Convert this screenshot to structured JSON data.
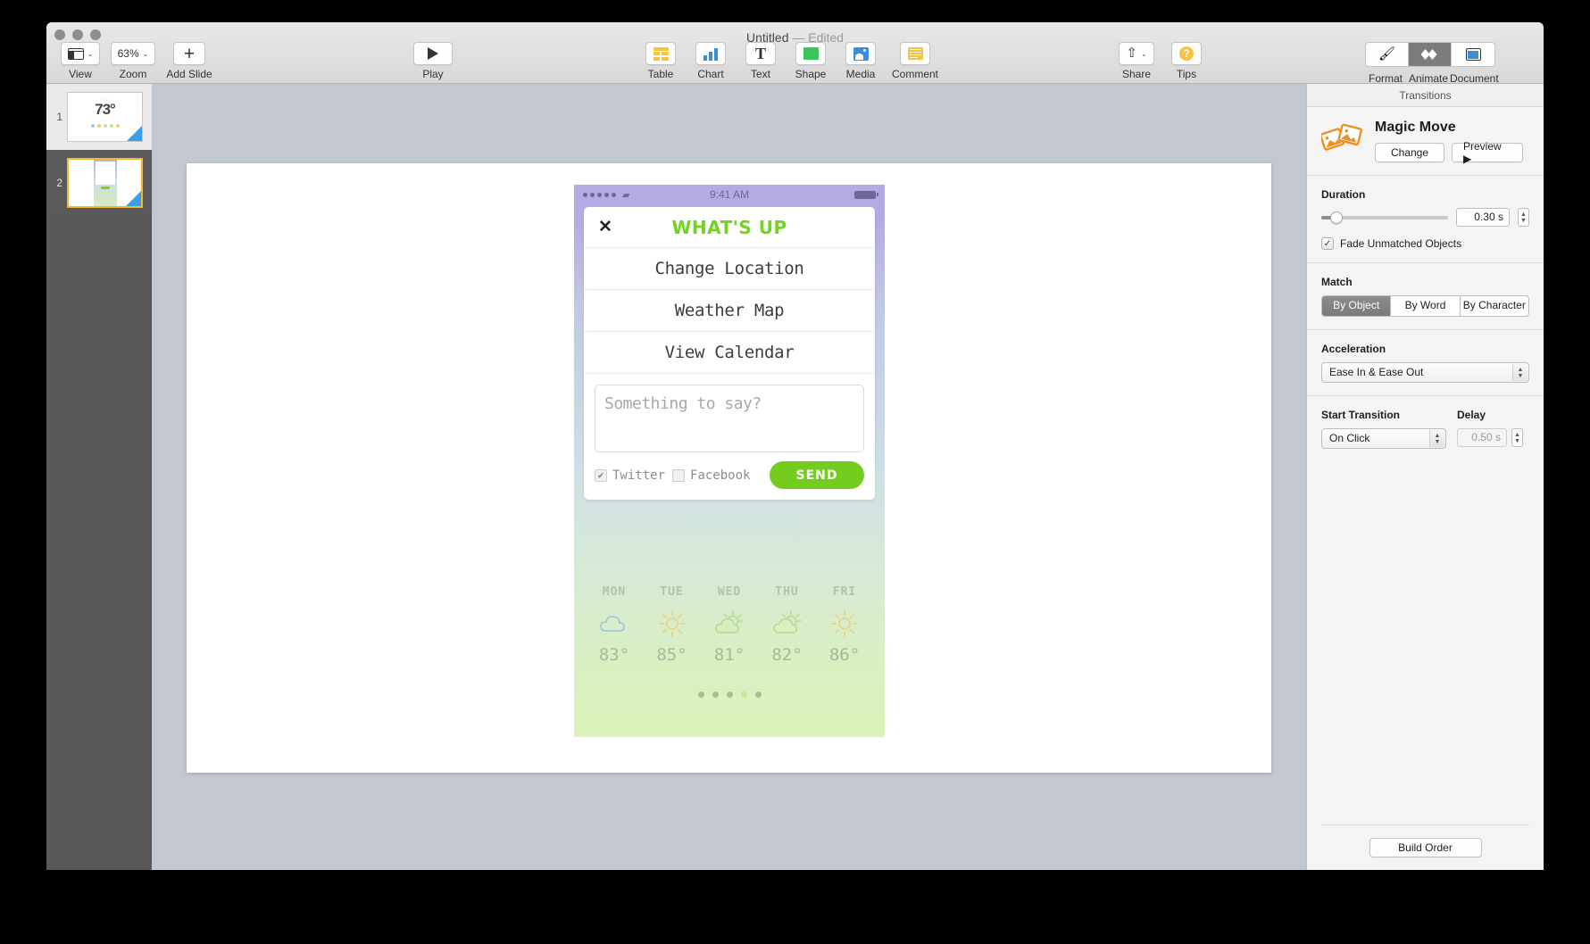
{
  "window": {
    "title": "Untitled",
    "state": "— Edited"
  },
  "toolbar": {
    "left": [
      {
        "label": "View",
        "icon": "view-layout-icon",
        "caret": "⌄"
      },
      {
        "label": "Zoom",
        "value": "63%",
        "icon": "zoom-value",
        "caret": "⌄"
      },
      {
        "label": "Add Slide",
        "icon": "plus-icon"
      }
    ],
    "play": {
      "label": "Play",
      "icon": "play-icon"
    },
    "insert": [
      {
        "label": "Table",
        "icon": "table-icon"
      },
      {
        "label": "Chart",
        "icon": "chart-icon"
      },
      {
        "label": "Text",
        "icon": "text-icon"
      },
      {
        "label": "Shape",
        "icon": "shape-icon"
      },
      {
        "label": "Media",
        "icon": "media-icon"
      },
      {
        "label": "Comment",
        "icon": "comment-icon"
      }
    ],
    "right": [
      {
        "label": "Share",
        "icon": "share-icon",
        "caret": "⌄"
      },
      {
        "label": "Tips",
        "icon": "tips-icon",
        "glyph": "?"
      }
    ],
    "inspector_tabs": [
      {
        "label": "Format",
        "icon": "paintbrush-icon",
        "active": false
      },
      {
        "label": "Animate",
        "icon": "diamonds-icon",
        "active": true
      },
      {
        "label": "Document",
        "icon": "document-icon",
        "active": false
      }
    ]
  },
  "navigator": {
    "slides": [
      {
        "number": "1",
        "selected": false,
        "temp": "73°"
      },
      {
        "number": "2",
        "selected": true
      }
    ]
  },
  "slide": {
    "phone": {
      "status_bar": {
        "time": "9:41 AM",
        "wifi": "wifi-icon",
        "signal_dots": 5
      },
      "sheet": {
        "close": "✕",
        "brand": "WHAT'S UP",
        "menu": [
          "Change Location",
          "Weather Map",
          "View Calendar"
        ],
        "compose_placeholder": "Something to say?",
        "checkboxes": [
          {
            "label": "Twitter",
            "checked": true
          },
          {
            "label": "Facebook",
            "checked": false
          }
        ],
        "send_label": "SEND"
      },
      "forecast": {
        "days": [
          {
            "day": "MON",
            "icon": "cloud-icon",
            "temp": "83°"
          },
          {
            "day": "TUE",
            "icon": "sun-icon",
            "temp": "85°"
          },
          {
            "day": "WED",
            "icon": "sun-behind-cloud-icon",
            "temp": "81°"
          },
          {
            "day": "THU",
            "icon": "sun-behind-cloud-icon",
            "temp": "82°"
          },
          {
            "day": "FRI",
            "icon": "sun-icon",
            "temp": "86°"
          }
        ],
        "page_dots": 5,
        "active_dot_index": 3
      }
    }
  },
  "inspector": {
    "panel_title": "Transitions",
    "transition": {
      "name": "Magic Move",
      "icon": "magic-move-icon",
      "change_label": "Change",
      "preview_label": "Preview ▶"
    },
    "duration": {
      "label": "Duration",
      "value": "0.30 s"
    },
    "fade_unmatched": {
      "label": "Fade Unmatched Objects",
      "checked": true,
      "check_glyph": "✓"
    },
    "match": {
      "label": "Match",
      "options": [
        "By Object",
        "By Word",
        "By Character"
      ],
      "selected": "By Object"
    },
    "acceleration": {
      "label": "Acceleration",
      "value": "Ease In & Ease Out"
    },
    "start_transition": {
      "label": "Start Transition",
      "value": "On Click"
    },
    "delay": {
      "label": "Delay",
      "value": "0.50 s"
    },
    "build_order_label": "Build Order"
  },
  "colors": {
    "brand_green": "#72d420",
    "send_green": "#74cc1e",
    "selection_yellow": "#f5b731",
    "transition_blue": "#3d9ee8",
    "magic_move_orange": "#ef8f22"
  }
}
